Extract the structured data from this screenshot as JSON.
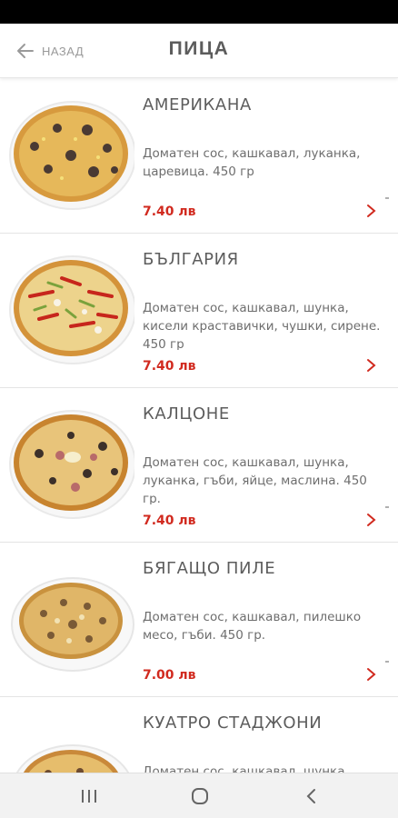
{
  "header": {
    "back_label": "НАЗАД",
    "title": "ПИЦА"
  },
  "colors": {
    "price": "#d12a1f",
    "chevron": "#d12a1f",
    "title": "#5c5c5c",
    "text": "#6e6e6e"
  },
  "icons": {
    "back": "arrow-left-icon",
    "chevron": "chevron-right-icon",
    "nav_recents": "recents-icon",
    "nav_home": "home-icon",
    "nav_back": "back-icon"
  },
  "menu": {
    "items": [
      {
        "name": "АМЕРИКАНА",
        "description": "Доматен сос, кашкавал, луканка, царевица. 450 гр",
        "price": "7.40 лв"
      },
      {
        "name": "БЪЛГАРИЯ",
        "description": "Доматен сос, кашкавал, шунка, кисели краставички, чушки, сирене. 450 гр",
        "price": "7.40 лв"
      },
      {
        "name": "КАЛЦОНЕ",
        "description": "Доматен сос, кашкавал, шунка, луканка, гъби, яйце, маслина. 450 гр.",
        "price": "7.40 лв"
      },
      {
        "name": "БЯГАЩО ПИЛЕ",
        "description": "Доматен сос, кашкавал, пилешко месо, гъби. 450 гр.",
        "price": "7.00 лв"
      },
      {
        "name": "КУАТРО СТАДЖОНИ",
        "description": "Доматен сос, кашкавал, шунка",
        "price": ""
      }
    ]
  }
}
